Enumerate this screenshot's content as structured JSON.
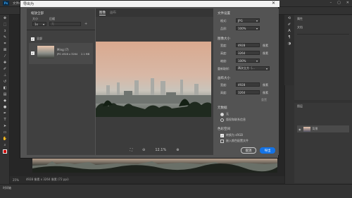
{
  "menubar": {
    "logo": "Ps",
    "items": [
      "文件(F)",
      "编辑(E)",
      "图像(I)",
      "图层(L)",
      "文字(Y)",
      "选择(S)",
      "滤镜(T)",
      "3D(D)",
      "视图(V)",
      "增效工具",
      "窗口(W)",
      "帮助(H)"
    ]
  },
  "dialog": {
    "title": "导出为",
    "left": {
      "scale_label": "缩放全部",
      "size_header": "大小",
      "suffix_header": "后缀",
      "scale_value": "1x",
      "suffix_placeholder": "无",
      "all_label": "全部",
      "item_name": "Ming (7)",
      "item_meta": "JPG  4928 x 3264",
      "item_size": "2.1 MB"
    },
    "center": {
      "tabs": [
        "图像",
        "画布"
      ],
      "zoom": "12.1%"
    },
    "right": {
      "file_settings": "文件设置",
      "format_label": "格式:",
      "format_value": "JPG",
      "quality_label": "品质:",
      "quality_value": "100%",
      "image_size": "图像大小",
      "width_label": "宽度:",
      "height_label": "高度:",
      "scale_label": "缩放:",
      "resample_label": "重新取样:",
      "width_value": "4928",
      "height_value": "3264",
      "scale_value": "100%",
      "resample_value": "两次立方（...",
      "unit": "像素",
      "canvas_size": "画布大小",
      "c_width_value": "4928",
      "c_height_value": "3264",
      "reset": "重置",
      "metadata": "元数据",
      "meta_none": "无",
      "meta_copyright": "版权和联系信息",
      "color_space": "色彩空间",
      "srgb": "转换为 sRGB",
      "embed_profile": "嵌入颜色配置文件",
      "cancel": "取消",
      "export": "导出"
    }
  },
  "status": {
    "zoom": "25%",
    "doc": "4928 像素 x 3264 像素 (72 ppi)"
  },
  "timeline": {
    "label": "时间轴"
  },
  "panels": {
    "properties": "属性",
    "layers": "图层",
    "doc_label": "文档",
    "layer_name": "背景"
  },
  "colors": {
    "accent": "#1473e6",
    "dialog_bg": "#535353"
  }
}
